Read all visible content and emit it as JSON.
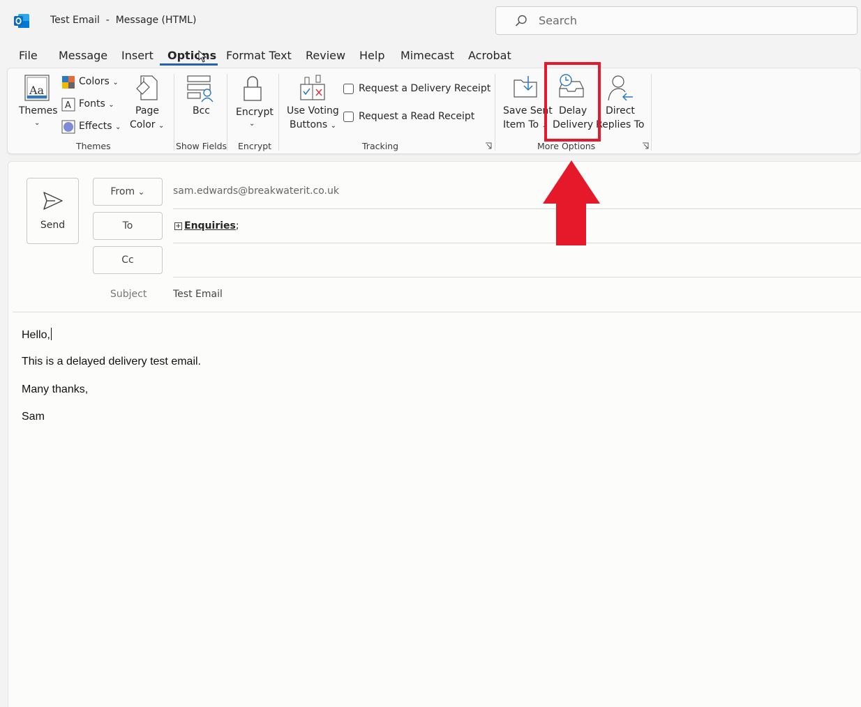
{
  "window": {
    "title": "Test Email  -  Message (HTML)",
    "search_placeholder": "Search"
  },
  "menu": {
    "tabs": [
      "File",
      "Message",
      "Insert",
      "Options",
      "Format Text",
      "Review",
      "Help",
      "Mimecast",
      "Acrobat"
    ],
    "active": "Options"
  },
  "ribbon": {
    "themes_group": {
      "themes": "Themes",
      "colors": "Colors",
      "fonts": "Fonts",
      "effects": "Effects",
      "page_color_1": "Page",
      "page_color_2": "Color",
      "label": "Themes"
    },
    "show_fields_group": {
      "bcc": "Bcc",
      "label": "Show Fields"
    },
    "encrypt_group": {
      "encrypt": "Encrypt",
      "label": "Encrypt"
    },
    "tracking_group": {
      "voting_1": "Use Voting",
      "voting_2": "Buttons",
      "delivery_receipt": "Request a Delivery Receipt",
      "read_receipt": "Request a Read Receipt",
      "label": "Tracking"
    },
    "more_options_group": {
      "save_sent_1": "Save Sent",
      "save_sent_2": "Item To",
      "delay_1": "Delay",
      "delay_2": "Delivery",
      "direct_1": "Direct",
      "direct_2": "Replies To",
      "label": "More Options"
    }
  },
  "compose": {
    "send": "Send",
    "from_button": "From",
    "from_value": "sam.edwards@breakwaterit.co.uk",
    "to_button": "To",
    "to_value": "Enquiries",
    "to_suffix": ";",
    "cc_button": "Cc",
    "subject_label": "Subject",
    "subject_value": "Test Email"
  },
  "body": {
    "lines": [
      "Hello,",
      "This is a delayed delivery test email.",
      "Many thanks,",
      "Sam"
    ]
  },
  "colors": {
    "accent": "#2160b2",
    "highlight": "#e5192a"
  }
}
